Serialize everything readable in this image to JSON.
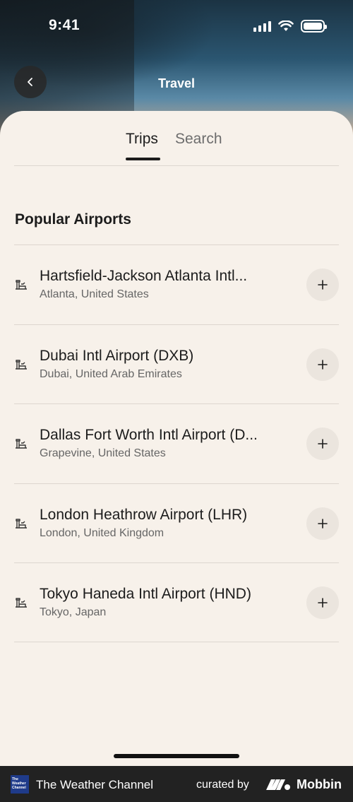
{
  "status_bar": {
    "time": "9:41"
  },
  "header": {
    "title": "Travel"
  },
  "tabs": [
    {
      "label": "Trips",
      "active": true
    },
    {
      "label": "Search",
      "active": false
    }
  ],
  "section": {
    "title": "Popular Airports"
  },
  "airports": [
    {
      "name": "Hartsfield-Jackson Atlanta Intl...",
      "location": "Atlanta, United States"
    },
    {
      "name": "Dubai Intl Airport (DXB)",
      "location": "Dubai, United Arab Emirates"
    },
    {
      "name": "Dallas Fort Worth Intl Airport (D...",
      "location": "Grapevine, United States"
    },
    {
      "name": "London Heathrow Airport (LHR)",
      "location": "London, United Kingdom"
    },
    {
      "name": "Tokyo Haneda Intl Airport (HND)",
      "location": "Tokyo, Japan"
    }
  ],
  "icons": {
    "back": "chevron-left-icon",
    "airport": "airport-tower-icon",
    "add": "plus-icon"
  },
  "footer": {
    "app_logo_text": "The Weather Channel",
    "app_name": "The Weather Channel",
    "curated_by": "curated by",
    "brand": "Mobbin"
  },
  "colors": {
    "sheet_background": "#f7f1ea",
    "text_primary": "#1c1c1c",
    "text_secondary": "#666666",
    "button_background": "#ebe5de",
    "footer_background": "#222222"
  }
}
